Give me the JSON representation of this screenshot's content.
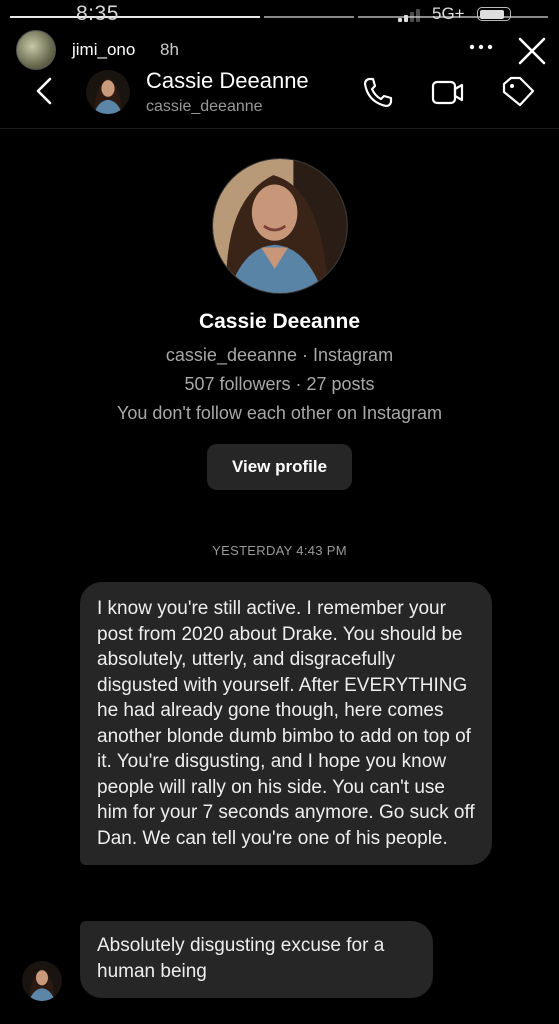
{
  "status_bar": {
    "time": "8:35",
    "network": "5G+",
    "signal_bars_active": 2,
    "signal_bars_total": 4,
    "battery_level": 0.85
  },
  "story": {
    "username": "jimi_ono",
    "age": "8h",
    "progress": [
      1.0,
      0.0,
      0.0
    ]
  },
  "header": {
    "name": "Cassie Deeanne",
    "handle": "cassie_deeanne",
    "icons": [
      "back-icon",
      "phone-icon",
      "video-icon",
      "tag-icon"
    ]
  },
  "profile": {
    "name": "Cassie Deeanne",
    "handle_line": "cassie_deeanne · Instagram",
    "stats_line": "507 followers · 27 posts",
    "follow_line": "You don't follow each other on Instagram",
    "view_profile_label": "View profile"
  },
  "conversation": {
    "timestamp": "YESTERDAY 4:43 PM",
    "messages": [
      {
        "sender": "cassie_deeanne",
        "text": "I know you're still active. I remember your post from 2020 about Drake. You should be absolutely, utterly, and disgracefully disgusted with yourself. After EVERYTHING he had already gone though, here comes another blonde dumb bimbo to add on top of it. You're disgusting, and I hope you know people will rally on his side. You can't use him for your 7 seconds anymore. Go suck off Dan. We can tell you're one of his people."
      },
      {
        "sender": "cassie_deeanne",
        "text": "Absolutely disgusting excuse for a human being"
      }
    ]
  }
}
